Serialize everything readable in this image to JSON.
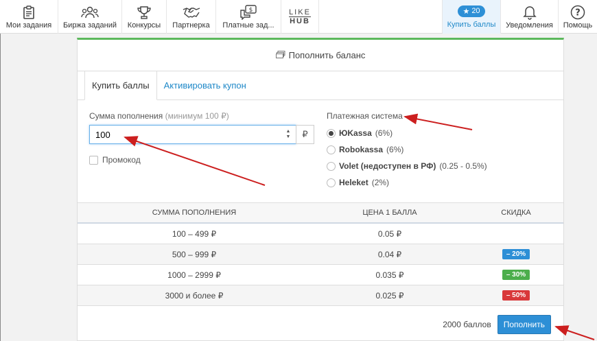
{
  "nav": {
    "my_tasks": "Мои задания",
    "exchange": "Биржа заданий",
    "contests": "Конкурсы",
    "partner": "Партнерка",
    "paid": "Платные зад...",
    "logo_top": "LIKE",
    "logo_bottom": "HUB",
    "points_count": "20",
    "buy_points": "Купить баллы",
    "notifications": "Уведомления",
    "help": "Помощь"
  },
  "panel": {
    "title": "Пополнить баланс",
    "tab_buy": "Купить баллы",
    "tab_coupon": "Активировать купон"
  },
  "form": {
    "amount_label": "Сумма пополнения",
    "amount_hint": "(минимум 100 ₽)",
    "amount_value": "100",
    "currency": "₽",
    "promo_label": "Промокод",
    "payment_label": "Платежная система",
    "systems": [
      {
        "name": "ЮKassa",
        "note": "(6%)",
        "selected": true
      },
      {
        "name": "Robokassa",
        "note": "(6%)",
        "selected": false
      },
      {
        "name": "Volet (недоступен в РФ)",
        "note": "(0.25 - 0.5%)",
        "selected": false
      },
      {
        "name": "Heleket",
        "note": "(2%)",
        "selected": false
      }
    ]
  },
  "table": {
    "headers": [
      "СУММА ПОПОЛНЕНИЯ",
      "ЦЕНА 1 БАЛЛА",
      "СКИДКА"
    ],
    "rows": [
      {
        "range": "100 – 499 ₽",
        "price": "0.05 ₽",
        "discount": ""
      },
      {
        "range": "500 – 999 ₽",
        "price": "0.04 ₽",
        "discount": "– 20%"
      },
      {
        "range": "1000 – 2999 ₽",
        "price": "0.035 ₽",
        "discount": "– 30%"
      },
      {
        "range": "3000 и более ₽",
        "price": "0.025 ₽",
        "discount": "– 50%"
      }
    ],
    "discount_colors": [
      "#2d8fd6",
      "#4cae4c",
      "#d9383a"
    ]
  },
  "footer": {
    "total": "2000 баллов",
    "submit": "Пополнить"
  },
  "colors": {
    "accent": "#2d8fd6",
    "panel_top": "#5cb85c",
    "arrow": "#cc1f1f"
  }
}
